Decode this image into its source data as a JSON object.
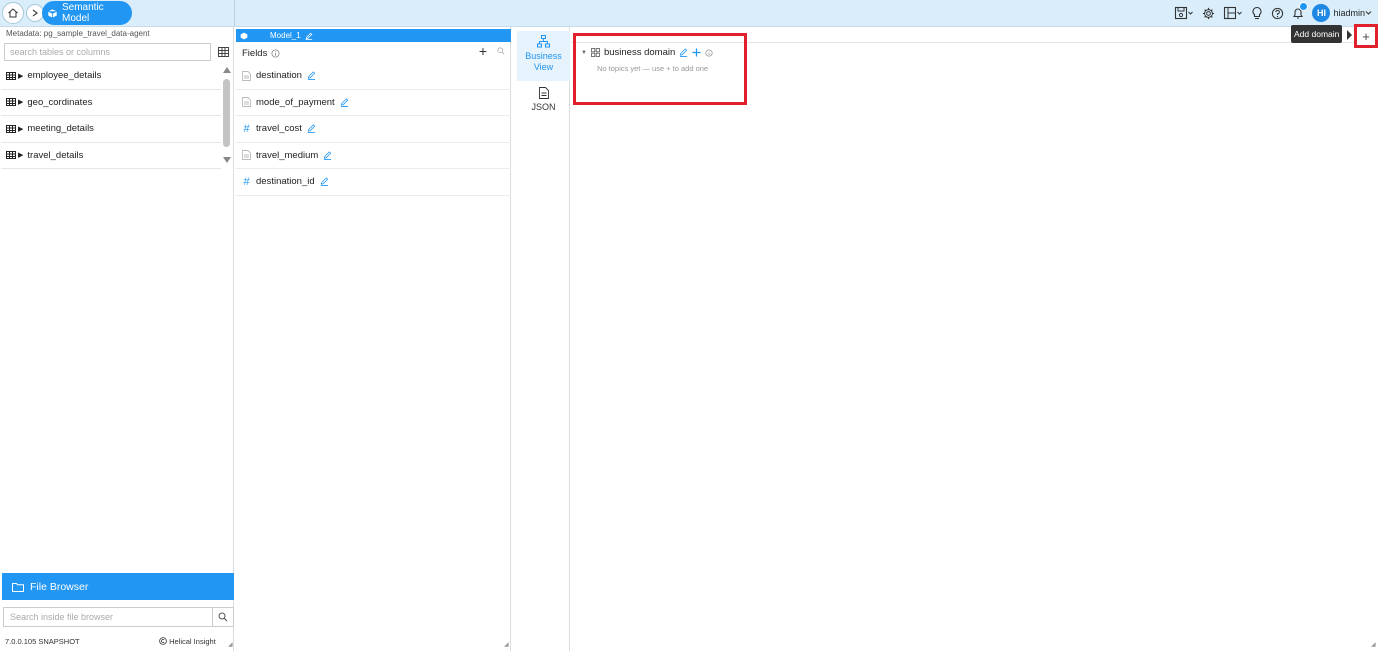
{
  "breadcrumb": {
    "home_icon": "home-icon",
    "separator": ">",
    "current": "Semantic Model"
  },
  "user": {
    "initials": "HI",
    "name": "hiadmin"
  },
  "left": {
    "metadata_label": "Metadata: pg_sample_travel_data-agent",
    "search_placeholder": "search tables or columns",
    "tables": [
      {
        "label": "employee_details"
      },
      {
        "label": "geo_cordinates"
      },
      {
        "label": "meeting_details"
      },
      {
        "label": "travel_details"
      }
    ],
    "file_browser_label": "File Browser",
    "file_search_placeholder": "Search inside file browser",
    "version": "7.0.0.105 SNAPSHOT",
    "copyright": "Helical Insight"
  },
  "fields_panel": {
    "model_name": "Model_1",
    "header": "Fields",
    "add": "+",
    "fields": [
      {
        "label": "destination",
        "type": "text"
      },
      {
        "label": "mode_of_payment",
        "type": "text"
      },
      {
        "label": "travel_cost",
        "type": "number"
      },
      {
        "label": "travel_medium",
        "type": "text"
      },
      {
        "label": "destination_id",
        "type": "number"
      }
    ]
  },
  "views": {
    "business_view": "Business\nView",
    "business_view_line1": "Business",
    "business_view_line2": "View",
    "json_view": "JSON"
  },
  "main": {
    "domain_name": "business domain",
    "no_topics": "No topics yet — use + to add one",
    "add_domain_tooltip": "Add domain",
    "add_symbol": "+"
  },
  "colors": {
    "accent": "#2196f3",
    "topbar": "#d9eefa",
    "highlight": "#e0202a"
  }
}
